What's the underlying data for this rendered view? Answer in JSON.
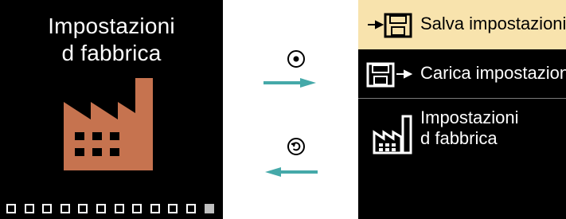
{
  "left_screen": {
    "title_line1": "Impostazioni",
    "title_line2": "d fabbrica",
    "icon": "factory-icon",
    "icon_color": "#c6734f",
    "page_count": 12,
    "active_page": 12
  },
  "middle": {
    "confirm_icon": "confirm-dot-circle-icon",
    "back_icon": "back-circle-arrow-icon",
    "forward_arrow_icon": "forward-arrow-icon",
    "back_arrow_icon": "back-arrow-icon",
    "arrow_color": "#45a9a9"
  },
  "right_screen": {
    "menu_items": [
      {
        "icon": "save-floppy-arrow-icon",
        "label": "Salva impostazioni",
        "selected": true
      },
      {
        "icon": "load-floppy-arrow-icon",
        "label": "Carica impostazioni",
        "selected": false
      },
      {
        "icon": "factory-outline-icon",
        "label_line1": "Impostazioni",
        "label_line2": "d fabbrica",
        "selected": false
      }
    ],
    "selected_background": "#f8e3ad"
  }
}
